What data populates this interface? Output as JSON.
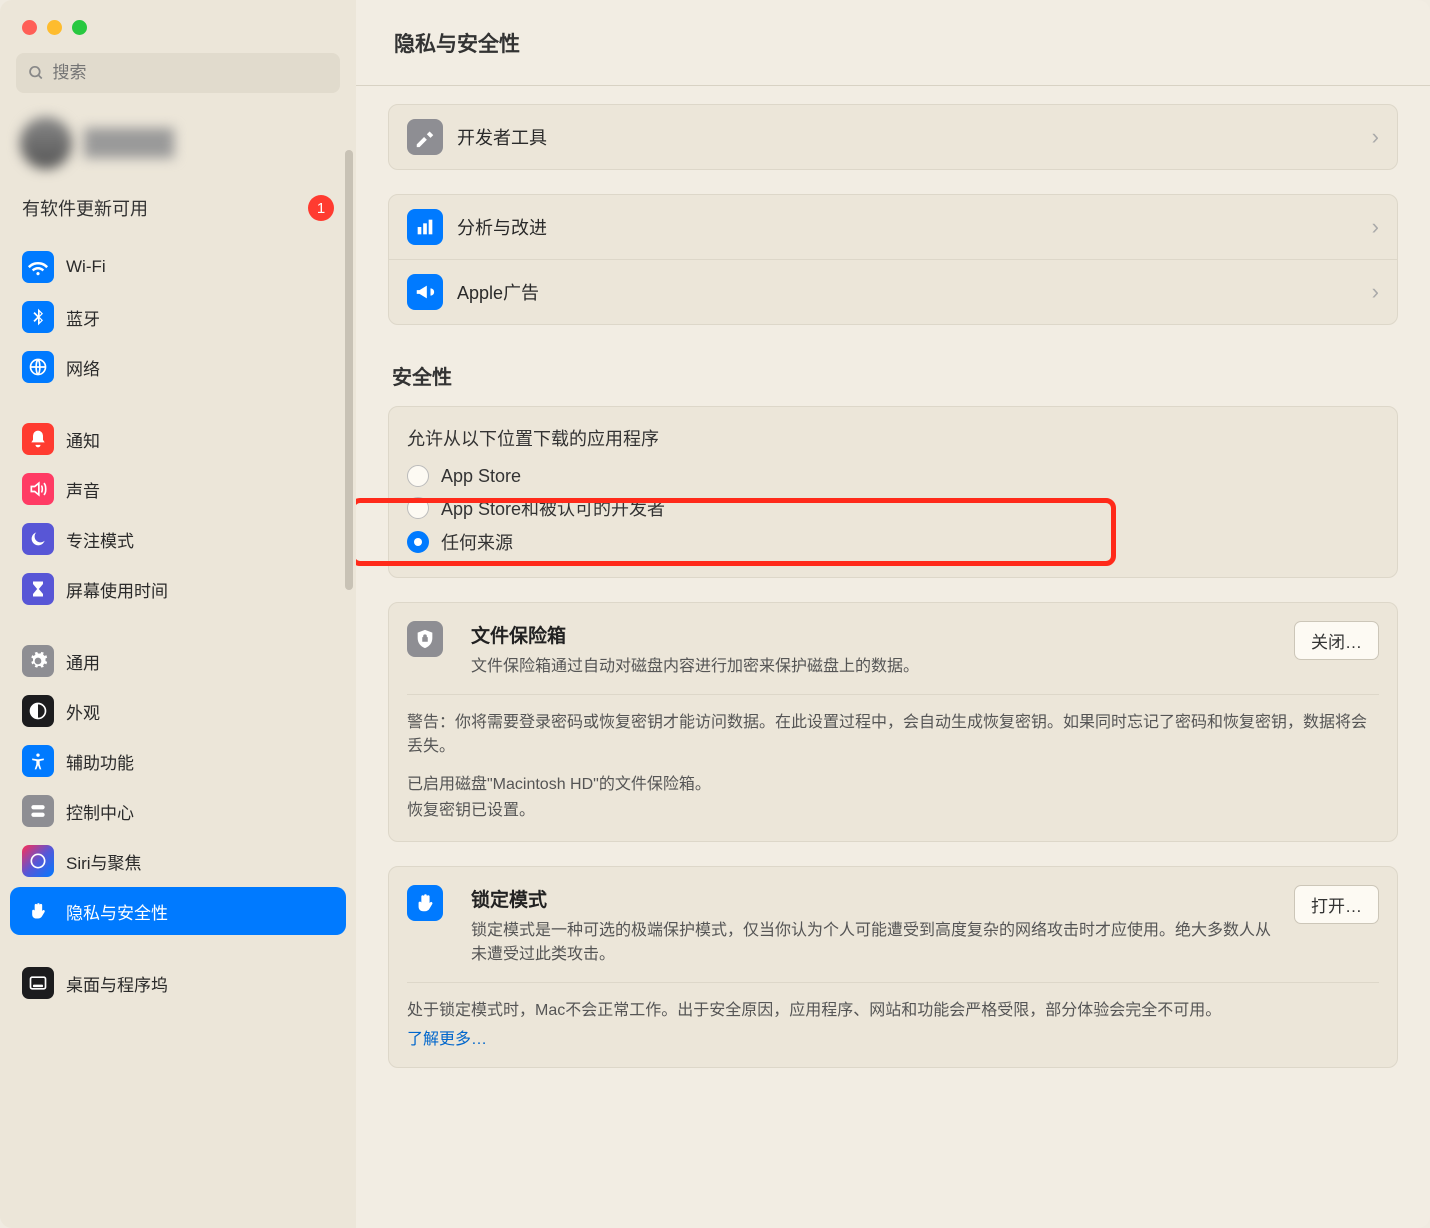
{
  "header": {
    "title": "隐私与安全性"
  },
  "search": {
    "placeholder": "搜索"
  },
  "update": {
    "label": "有软件更新可用",
    "badge": "1"
  },
  "sidebar": {
    "items": [
      {
        "label": "Wi-Fi"
      },
      {
        "label": "蓝牙"
      },
      {
        "label": "网络"
      },
      {
        "label": "通知"
      },
      {
        "label": "声音"
      },
      {
        "label": "专注模式"
      },
      {
        "label": "屏幕使用时间"
      },
      {
        "label": "通用"
      },
      {
        "label": "外观"
      },
      {
        "label": "辅助功能"
      },
      {
        "label": "控制中心"
      },
      {
        "label": "Siri与聚焦"
      },
      {
        "label": "隐私与安全性"
      },
      {
        "label": "桌面与程序坞"
      }
    ]
  },
  "rows": {
    "developer": "开发者工具",
    "analytics": "分析与改进",
    "ads": "Apple广告"
  },
  "section": {
    "security": "安全性"
  },
  "allow": {
    "title": "允许从以下位置下载的应用程序",
    "opt1": "App Store",
    "opt2": "App Store和被认可的开发者",
    "opt3": "任何来源"
  },
  "filevault": {
    "title": "文件保险箱",
    "desc": "文件保险箱通过自动对磁盘内容进行加密来保护磁盘上的数据。",
    "button": "关闭…",
    "warning": "警告：你将需要登录密码或恢复密钥才能访问数据。在此设置过程中，会自动生成恢复密钥。如果同时忘记了密码和恢复密钥，数据将会丢失。",
    "status1": "已启用磁盘\"Macintosh HD\"的文件保险箱。",
    "status2": "恢复密钥已设置。"
  },
  "lockdown": {
    "title": "锁定模式",
    "desc": "锁定模式是一种可选的极端保护模式，仅当你认为个人可能遭受到高度复杂的网络攻击时才应使用。绝大多数人从未遭受过此类攻击。",
    "button": "打开…",
    "body": "处于锁定模式时，Mac不会正常工作。出于安全原因，应用程序、网站和功能会严格受限，部分体验会完全不可用。",
    "link": "了解更多…"
  }
}
